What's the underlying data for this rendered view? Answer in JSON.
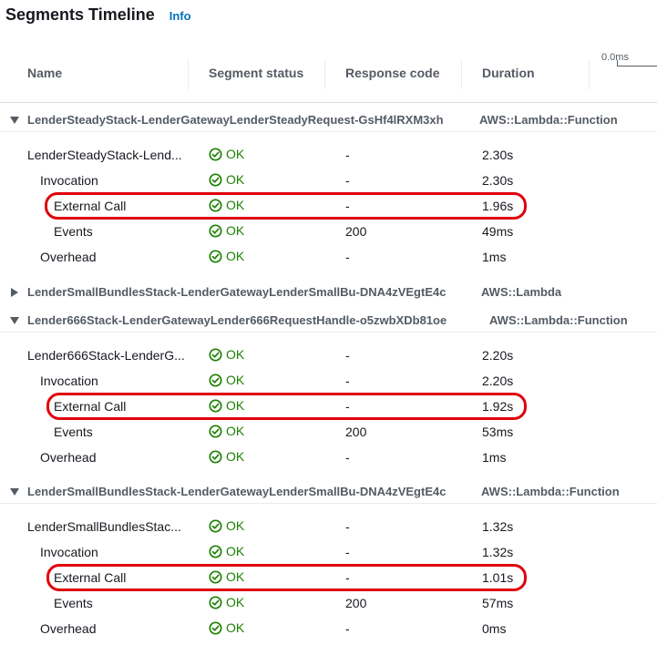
{
  "page": {
    "title": "Segments Timeline",
    "info_label": "Info"
  },
  "columns": {
    "name": "Name",
    "status": "Segment status",
    "response_code": "Response code",
    "duration": "Duration",
    "scale_label": "0.0ms"
  },
  "colors": {
    "ok_green": "#1d8102",
    "highlight_red": "#e0000c",
    "info_blue": "#0073bb"
  },
  "groups": [
    {
      "name": "LenderSteadyStack-LenderGatewayLenderSteadyRequest-GsHf4lRXM3xh",
      "type": "AWS::Lambda::Function",
      "expanded": true,
      "rows": [
        {
          "name": "LenderSteadyStack-Lend...",
          "status": "OK",
          "code": "-",
          "duration": "2.30s"
        },
        {
          "name": "Invocation",
          "status": "OK",
          "code": "-",
          "duration": "2.30s"
        },
        {
          "name": "External Call",
          "status": "OK",
          "code": "-",
          "duration": "1.96s"
        },
        {
          "name": "Events",
          "status": "OK",
          "code": "200",
          "duration": "49ms"
        },
        {
          "name": "Overhead",
          "status": "OK",
          "code": "-",
          "duration": "1ms"
        }
      ]
    },
    {
      "name": "LenderSmallBundlesStack-LenderGatewayLenderSmallBu-DNA4zVEgtE4c",
      "type": "AWS::Lambda",
      "expanded": false,
      "rows": []
    },
    {
      "name": "Lender666Stack-LenderGatewayLender666RequestHandle-o5zwbXDb81oe",
      "type": "AWS::Lambda::Function",
      "expanded": true,
      "rows": [
        {
          "name": "Lender666Stack-LenderG...",
          "status": "OK",
          "code": "-",
          "duration": "2.20s"
        },
        {
          "name": "Invocation",
          "status": "OK",
          "code": "-",
          "duration": "2.20s"
        },
        {
          "name": "External Call",
          "status": "OK",
          "code": "-",
          "duration": "1.92s"
        },
        {
          "name": "Events",
          "status": "OK",
          "code": "200",
          "duration": "53ms"
        },
        {
          "name": "Overhead",
          "status": "OK",
          "code": "-",
          "duration": "1ms"
        }
      ]
    },
    {
      "name": "LenderSmallBundlesStack-LenderGatewayLenderSmallBu-DNA4zVEgtE4c",
      "type": "AWS::Lambda::Function",
      "expanded": true,
      "rows": [
        {
          "name": "LenderSmallBundlesStac...",
          "status": "OK",
          "code": "-",
          "duration": "1.32s"
        },
        {
          "name": "Invocation",
          "status": "OK",
          "code": "-",
          "duration": "1.32s"
        },
        {
          "name": "External Call",
          "status": "OK",
          "code": "-",
          "duration": "1.01s"
        },
        {
          "name": "Events",
          "status": "OK",
          "code": "200",
          "duration": "57ms"
        },
        {
          "name": "Overhead",
          "status": "OK",
          "code": "-",
          "duration": "0ms"
        }
      ]
    }
  ]
}
